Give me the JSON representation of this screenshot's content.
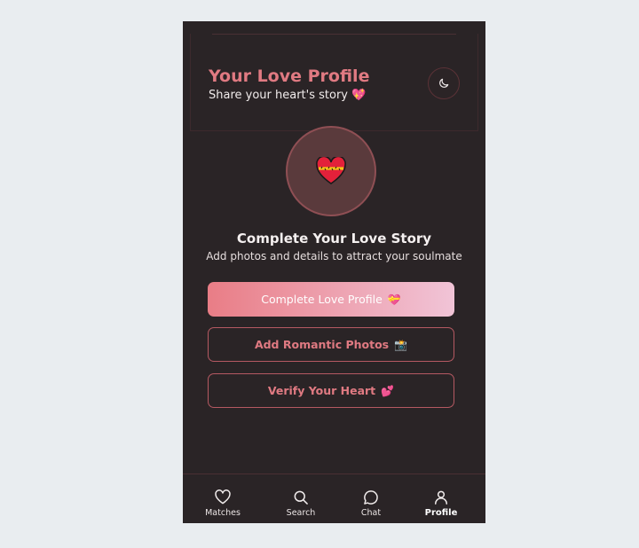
{
  "header": {
    "title": "Your Love Profile",
    "subtitle": "Share your heart's story",
    "subtitle_emoji": "💖",
    "theme_toggle_icon": "moon-icon"
  },
  "main": {
    "avatar_emoji": "❤️‍🩹",
    "title": "Complete Your Love Story",
    "subtitle": "Add photos and details to attract your soulmate"
  },
  "actions": {
    "complete": {
      "label": "Complete Love Profile",
      "emoji": "💝"
    },
    "photos": {
      "label": "Add Romantic Photos",
      "emoji": "📸"
    },
    "verify": {
      "label": "Verify Your Heart",
      "emoji": "💕"
    }
  },
  "nav": {
    "items": [
      {
        "label": "Matches",
        "icon": "heart-icon"
      },
      {
        "label": "Search",
        "icon": "search-icon"
      },
      {
        "label": "Chat",
        "icon": "chat-icon"
      },
      {
        "label": "Profile",
        "icon": "user-icon",
        "active": true
      }
    ]
  },
  "colors": {
    "accent": "#e07a82",
    "background": "#2a2426",
    "gradient_end": "#f1c4d7"
  }
}
